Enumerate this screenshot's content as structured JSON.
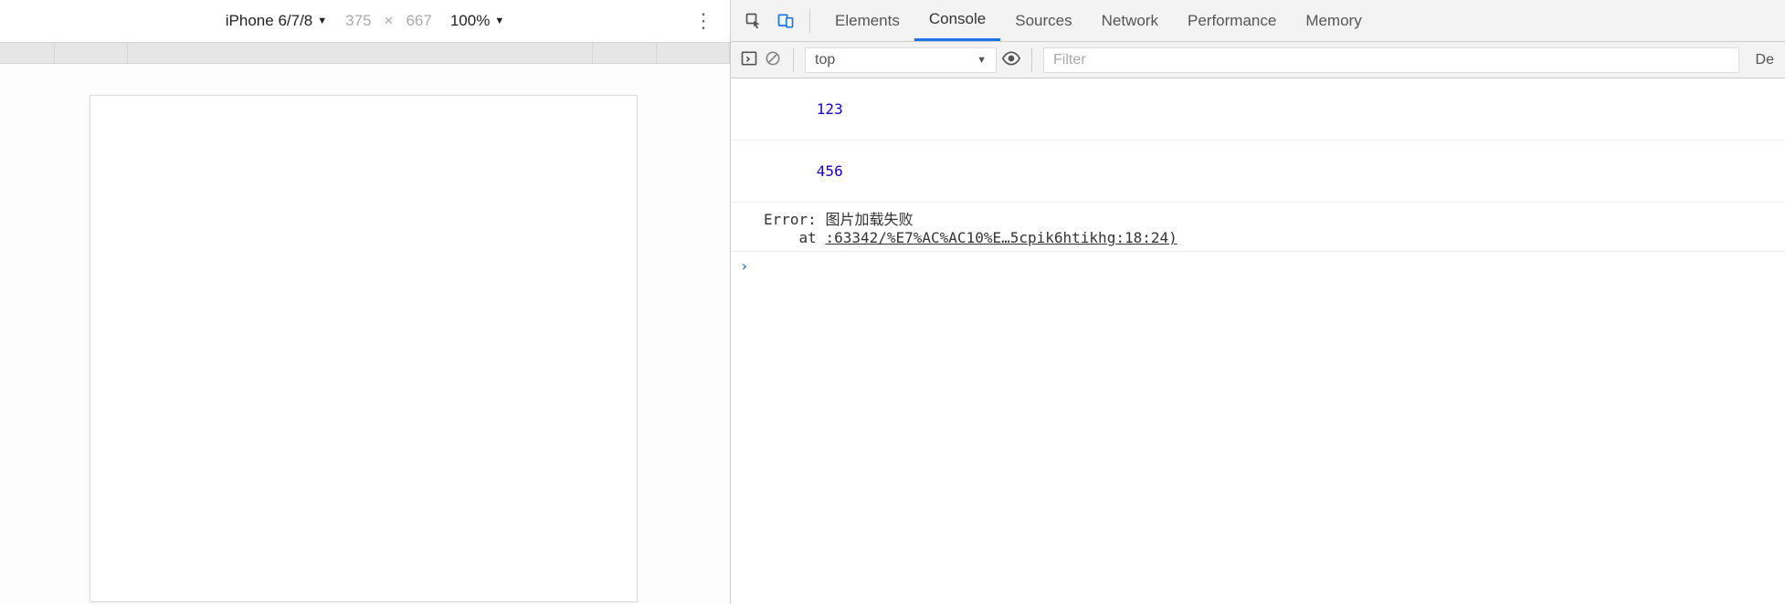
{
  "device_toolbar": {
    "device_name": "iPhone 6/7/8",
    "width": "375",
    "height": "667",
    "dim_sep": "×",
    "zoom": "100%"
  },
  "devtools": {
    "tabs": [
      "Elements",
      "Console",
      "Sources",
      "Network",
      "Performance",
      "Memory"
    ],
    "active_tab": "Console"
  },
  "console_toolbar": {
    "context": "top",
    "filter_placeholder": "Filter",
    "levels_label": "De"
  },
  "console_logs": {
    "log1": "123",
    "log2": "456",
    "error_label": "Error: ",
    "error_message": "图片加载失败",
    "error_at": "    at ",
    "error_link": ":63342/%E7%AC%AC10%E…5cpik6htikhg:18:24)"
  }
}
